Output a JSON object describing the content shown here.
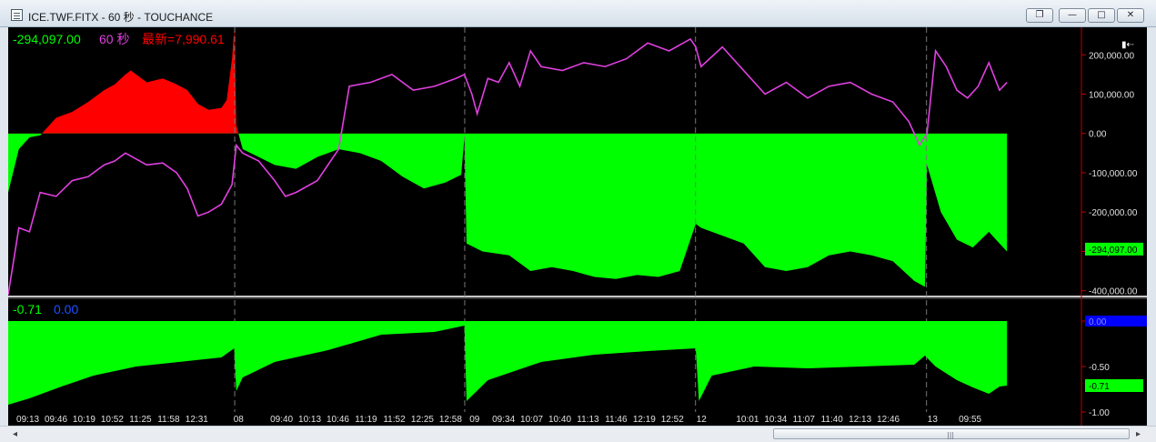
{
  "window": {
    "title": "ICE.TWF.FITX - 60 秒 - TOUCHANCE",
    "buttons": {
      "restore": "❐",
      "minimize": "—",
      "maximize": "□",
      "close": "✕"
    }
  },
  "top_panel": {
    "legend_value": "-294,097.00",
    "legend_interval": "60 秒",
    "legend_latest": "最新=7,990.61",
    "corner_icon": "▮⇠"
  },
  "bottom_panel": {
    "legend_value": "-0.71",
    "legend_value2": "0.00"
  },
  "colors": {
    "green": "#00ff00",
    "red": "#ff0000",
    "magenta": "#e040e0",
    "blue": "#0000ff",
    "axis_red": "#c00000"
  },
  "chart_data": [
    {
      "type": "area",
      "title": "",
      "ylim": [
        -410000,
        270000
      ],
      "yticks": [
        "200,000.00",
        "100,000.00",
        "0.00",
        "-100,000.00",
        "-200,000.00",
        "-300,000.00",
        "-400,000.00"
      ],
      "ytick_values": [
        200000,
        100000,
        0,
        -100000,
        -200000,
        -300000,
        -400000
      ],
      "last_value_label": "-294,097.00",
      "last_value": -294097,
      "session_dividers": [
        0.2125,
        0.4283,
        0.6448,
        0.8615
      ],
      "series": [
        {
          "name": "",
          "kind": "filled-area",
          "points": [
            [
              0,
              -150000
            ],
            [
              0.01,
              -40000
            ],
            [
              0.02,
              -10000
            ],
            [
              0.03,
              -5000
            ],
            [
              0.045,
              40000
            ],
            [
              0.06,
              55000
            ],
            [
              0.075,
              80000
            ],
            [
              0.09,
              110000
            ],
            [
              0.1,
              125000
            ],
            [
              0.11,
              150000
            ],
            [
              0.115,
              160000
            ],
            [
              0.13,
              130000
            ],
            [
              0.145,
              140000
            ],
            [
              0.158,
              125000
            ],
            [
              0.168,
              110000
            ],
            [
              0.178,
              75000
            ],
            [
              0.188,
              60000
            ],
            [
              0.2,
              65000
            ],
            [
              0.205,
              85000
            ],
            [
              0.21,
              190000
            ],
            [
              0.212,
              265000
            ],
            [
              0.214,
              20000
            ],
            [
              0.22,
              -40000
            ],
            [
              0.235,
              -60000
            ],
            [
              0.25,
              -80000
            ],
            [
              0.27,
              -90000
            ],
            [
              0.29,
              -60000
            ],
            [
              0.31,
              -40000
            ],
            [
              0.33,
              -50000
            ],
            [
              0.35,
              -70000
            ],
            [
              0.37,
              -110000
            ],
            [
              0.39,
              -140000
            ],
            [
              0.41,
              -125000
            ],
            [
              0.425,
              -105000
            ],
            [
              0.428,
              -10000
            ],
            [
              0.43,
              -280000
            ],
            [
              0.445,
              -300000
            ],
            [
              0.47,
              -310000
            ],
            [
              0.49,
              -350000
            ],
            [
              0.51,
              -340000
            ],
            [
              0.53,
              -350000
            ],
            [
              0.55,
              -365000
            ],
            [
              0.57,
              -370000
            ],
            [
              0.59,
              -360000
            ],
            [
              0.61,
              -365000
            ],
            [
              0.63,
              -350000
            ],
            [
              0.645,
              -230000
            ],
            [
              0.65,
              -240000
            ],
            [
              0.67,
              -260000
            ],
            [
              0.69,
              -280000
            ],
            [
              0.71,
              -340000
            ],
            [
              0.73,
              -350000
            ],
            [
              0.75,
              -340000
            ],
            [
              0.77,
              -310000
            ],
            [
              0.79,
              -300000
            ],
            [
              0.81,
              -310000
            ],
            [
              0.83,
              -325000
            ],
            [
              0.85,
              -375000
            ],
            [
              0.86,
              -390000
            ],
            [
              0.862,
              -80000
            ],
            [
              0.875,
              -200000
            ],
            [
              0.89,
              -270000
            ],
            [
              0.905,
              -290000
            ],
            [
              0.92,
              -250000
            ],
            [
              0.93,
              -280000
            ],
            [
              0.937,
              -300000
            ]
          ]
        },
        {
          "name": "",
          "kind": "line",
          "points": [
            [
              0,
              -410000
            ],
            [
              0.01,
              -240000
            ],
            [
              0.02,
              -250000
            ],
            [
              0.03,
              -150000
            ],
            [
              0.045,
              -160000
            ],
            [
              0.06,
              -120000
            ],
            [
              0.075,
              -110000
            ],
            [
              0.09,
              -80000
            ],
            [
              0.1,
              -70000
            ],
            [
              0.11,
              -50000
            ],
            [
              0.13,
              -80000
            ],
            [
              0.145,
              -75000
            ],
            [
              0.158,
              -100000
            ],
            [
              0.168,
              -140000
            ],
            [
              0.178,
              -210000
            ],
            [
              0.188,
              -200000
            ],
            [
              0.2,
              -180000
            ],
            [
              0.21,
              -130000
            ],
            [
              0.214,
              -30000
            ],
            [
              0.22,
              -50000
            ],
            [
              0.235,
              -70000
            ],
            [
              0.25,
              -120000
            ],
            [
              0.26,
              -160000
            ],
            [
              0.27,
              -150000
            ],
            [
              0.29,
              -120000
            ],
            [
              0.31,
              -40000
            ],
            [
              0.32,
              120000
            ],
            [
              0.34,
              130000
            ],
            [
              0.36,
              150000
            ],
            [
              0.38,
              110000
            ],
            [
              0.4,
              120000
            ],
            [
              0.42,
              140000
            ],
            [
              0.428,
              150000
            ],
            [
              0.435,
              100000
            ],
            [
              0.44,
              50000
            ],
            [
              0.45,
              140000
            ],
            [
              0.46,
              130000
            ],
            [
              0.47,
              180000
            ],
            [
              0.48,
              120000
            ],
            [
              0.49,
              210000
            ],
            [
              0.5,
              170000
            ],
            [
              0.52,
              160000
            ],
            [
              0.54,
              180000
            ],
            [
              0.56,
              170000
            ],
            [
              0.58,
              190000
            ],
            [
              0.6,
              230000
            ],
            [
              0.62,
              210000
            ],
            [
              0.64,
              240000
            ],
            [
              0.645,
              220000
            ],
            [
              0.65,
              170000
            ],
            [
              0.67,
              220000
            ],
            [
              0.69,
              160000
            ],
            [
              0.71,
              100000
            ],
            [
              0.73,
              130000
            ],
            [
              0.75,
              90000
            ],
            [
              0.77,
              120000
            ],
            [
              0.79,
              130000
            ],
            [
              0.81,
              100000
            ],
            [
              0.83,
              80000
            ],
            [
              0.845,
              30000
            ],
            [
              0.855,
              -30000
            ],
            [
              0.862,
              0
            ],
            [
              0.87,
              210000
            ],
            [
              0.88,
              170000
            ],
            [
              0.89,
              110000
            ],
            [
              0.9,
              90000
            ],
            [
              0.91,
              120000
            ],
            [
              0.92,
              180000
            ],
            [
              0.93,
              110000
            ],
            [
              0.937,
              130000
            ]
          ]
        }
      ]
    },
    {
      "type": "area",
      "title": "",
      "ylim": [
        -1.0,
        0.2
      ],
      "yticks": [
        "0.00",
        "-0.50",
        "-1.00"
      ],
      "ytick_values": [
        0,
        -0.5,
        -1
      ],
      "current_label": "0.00",
      "last_value_label": "-0.71",
      "last_value": -0.71,
      "series": [
        {
          "name": "",
          "kind": "filled-area",
          "points": [
            [
              0,
              -0.92
            ],
            [
              0.02,
              -0.85
            ],
            [
              0.05,
              -0.72
            ],
            [
              0.08,
              -0.6
            ],
            [
              0.12,
              -0.5
            ],
            [
              0.16,
              -0.45
            ],
            [
              0.2,
              -0.4
            ],
            [
              0.212,
              -0.3
            ],
            [
              0.214,
              -0.77
            ],
            [
              0.22,
              -0.62
            ],
            [
              0.25,
              -0.45
            ],
            [
              0.3,
              -0.32
            ],
            [
              0.35,
              -0.15
            ],
            [
              0.4,
              -0.12
            ],
            [
              0.428,
              -0.05
            ],
            [
              0.43,
              -0.88
            ],
            [
              0.45,
              -0.65
            ],
            [
              0.5,
              -0.45
            ],
            [
              0.55,
              -0.37
            ],
            [
              0.6,
              -0.33
            ],
            [
              0.645,
              -0.3
            ],
            [
              0.648,
              -0.88
            ],
            [
              0.66,
              -0.6
            ],
            [
              0.7,
              -0.5
            ],
            [
              0.75,
              -0.52
            ],
            [
              0.8,
              -0.5
            ],
            [
              0.85,
              -0.48
            ],
            [
              0.86,
              -0.38
            ],
            [
              0.87,
              -0.5
            ],
            [
              0.89,
              -0.65
            ],
            [
              0.905,
              -0.73
            ],
            [
              0.92,
              -0.8
            ],
            [
              0.93,
              -0.72
            ],
            [
              0.937,
              -0.71
            ]
          ]
        }
      ]
    }
  ],
  "x_axis": {
    "labels": [
      "09:13",
      "09:46",
      "10:19",
      "10:52",
      "11:25",
      "11:58",
      "12:31",
      "08",
      "09:40",
      "10:13",
      "10:46",
      "11:19",
      "11:52",
      "12:25",
      "12:58",
      "09",
      "09:34",
      "10:07",
      "10:40",
      "11:13",
      "11:46",
      "12:19",
      "12:52",
      "12",
      "10:01",
      "10:34",
      "11:07",
      "11:40",
      "12:13",
      "12:46",
      "13",
      "09:55"
    ],
    "positions": [
      0.0184,
      0.0448,
      0.0712,
      0.0976,
      0.1241,
      0.1505,
      0.1769,
      0.2161,
      0.2565,
      0.2829,
      0.3093,
      0.3357,
      0.3622,
      0.3886,
      0.415,
      0.4375,
      0.4647,
      0.4911,
      0.5175,
      0.5439,
      0.5703,
      0.5967,
      0.6231,
      0.6504,
      0.6936,
      0.72,
      0.7464,
      0.7728,
      0.7992,
      0.8256,
      0.8672,
      0.9024
    ]
  },
  "scrollbar": {
    "left_arrow": "◂",
    "right_arrow": "▸",
    "grip": "|||"
  }
}
